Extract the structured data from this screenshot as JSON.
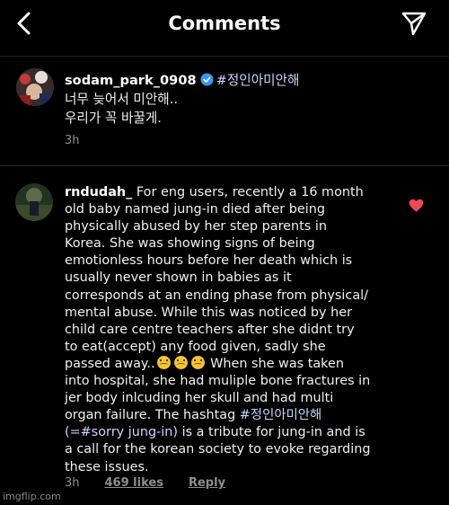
{
  "header": {
    "title": "Comments"
  },
  "caption": {
    "username": "sodam_park_0908",
    "hashtag": "#정인아미안해",
    "lines": [
      "너무 늦어서 미안해..",
      "우리가 꼭 바꿀게."
    ],
    "time": "3h"
  },
  "comment": {
    "username": "rndudah_",
    "first_line": "For eng users, recently a 16 month",
    "lines": [
      "old baby named jung-in died after being",
      "physically abused by her step parents in",
      "Korea. She was showing signs of being",
      "emotionless hours before her death which is",
      "usually never shown in babies as it",
      "corresponds at an ending phase from physical/",
      "mental abuse. While this was noticed by her",
      "child care centre teachers after she didnt try",
      "to eat(accept) any food given, sadly she"
    ],
    "line_emoji_before": "passed away..",
    "line_emoji_after": "When she was taken",
    "lines2": [
      "into hospital, she had muliple bone fractures in",
      "jer body inlcuding her skull and had multi"
    ],
    "line_hashtag_before": "organ failure. The hashtag",
    "hashtag": "#정인아미안해",
    "hashtag2": "(=#sorry jung-in)",
    "line_after_hashtag2": "is a tribute for jung-in and is",
    "lines3": [
      "a call for the korean society to evoke regarding",
      "these issues."
    ],
    "time": "3h",
    "likes": "469 likes",
    "reply": "Reply"
  },
  "watermark": "imgflip.com",
  "colors": {
    "background": "#000000",
    "hashtag": "#c8d6ff",
    "verified": "#3897f0",
    "heart": "#ed4956",
    "meta": "#8e8e8e"
  },
  "icons": [
    "back-arrow-icon",
    "send-icon",
    "verified-badge-icon",
    "heart-icon",
    "crying-face-emoji"
  ]
}
